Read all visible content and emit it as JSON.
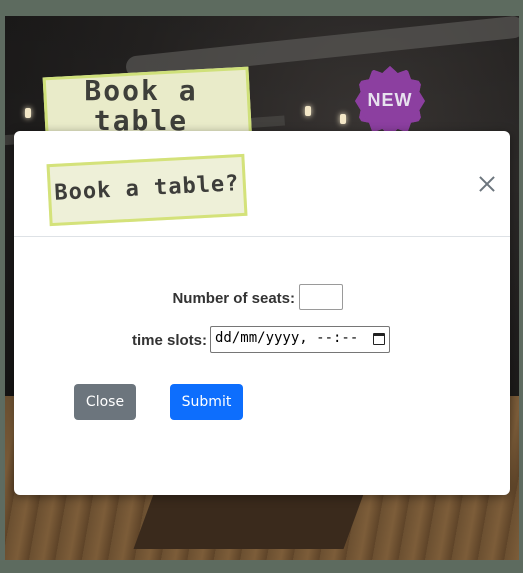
{
  "background": {
    "banner_text": "Book a table",
    "badge_text": "NEW"
  },
  "modal": {
    "title": "Book a table?",
    "close_icon": "close-icon",
    "fields": {
      "seats_label": "Number of seats:",
      "seats_value": "",
      "time_label": "time slots:",
      "time_placeholder": "dd/mm/yyyy, --:--"
    },
    "buttons": {
      "close_label": "Close",
      "submit_label": "Submit"
    }
  },
  "colors": {
    "primary": "#0d6efd",
    "secondary": "#6c757d",
    "badge": "#8c3fa0",
    "tag_border": "#d4e27a"
  }
}
